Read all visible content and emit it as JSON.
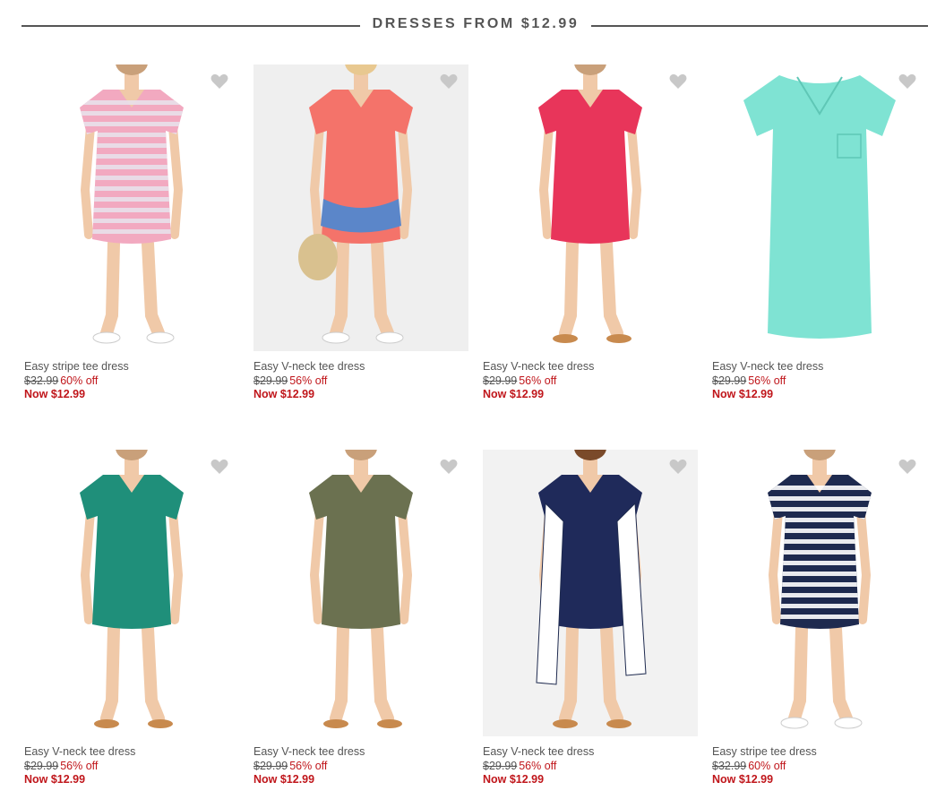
{
  "section": {
    "title": "DRESSES FROM $12.99"
  },
  "colors": {
    "sale_red": "#c0161b",
    "text_gray": "#555555",
    "heart_gray": "#c8c8c8"
  },
  "products": [
    {
      "name": "Easy stripe tee dress",
      "original_price": "$32.99",
      "discount": "60% off",
      "now_price": "Now $12.99",
      "dress_color": "#f2a9c0",
      "stripe_color": "#e8e0ea",
      "style": "stripe-pink",
      "bg": "#ffffff"
    },
    {
      "name": "Easy V-neck tee dress",
      "original_price": "$29.99",
      "discount": "56% off",
      "now_price": "Now $12.99",
      "dress_color": "#f4736a",
      "style": "model-coral",
      "bg": "#efefef"
    },
    {
      "name": "Easy V-neck tee dress",
      "original_price": "$29.99",
      "discount": "56% off",
      "now_price": "Now $12.99",
      "dress_color": "#e8355a",
      "style": "solid",
      "bg": "#ffffff"
    },
    {
      "name": "Easy V-neck tee dress",
      "original_price": "$29.99",
      "discount": "56% off",
      "now_price": "Now $12.99",
      "dress_color": "#7fe3d3",
      "style": "flat",
      "bg": "#ffffff"
    },
    {
      "name": "Easy V-neck tee dress",
      "original_price": "$29.99",
      "discount": "56% off",
      "now_price": "Now $12.99",
      "dress_color": "#1f8f7a",
      "style": "solid",
      "bg": "#ffffff"
    },
    {
      "name": "Easy V-neck tee dress",
      "original_price": "$29.99",
      "discount": "56% off",
      "now_price": "Now $12.99",
      "dress_color": "#6b7150",
      "style": "solid",
      "bg": "#ffffff"
    },
    {
      "name": "Easy V-neck tee dress",
      "original_price": "$29.99",
      "discount": "56% off",
      "now_price": "Now $12.99",
      "dress_color": "#1f2a5a",
      "style": "model-navy",
      "bg": "#f2f2f2"
    },
    {
      "name": "Easy stripe tee dress",
      "original_price": "$32.99",
      "discount": "60% off",
      "now_price": "Now $12.99",
      "dress_color": "#1e2a4f",
      "stripe_color": "#ffffff",
      "style": "stripe-navy",
      "bg": "#ffffff"
    }
  ]
}
